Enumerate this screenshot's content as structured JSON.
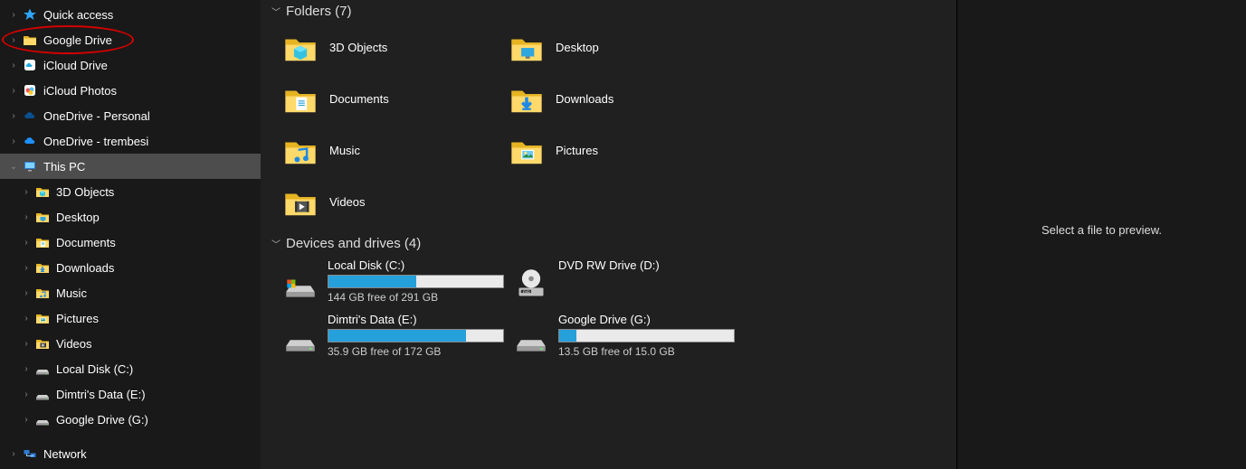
{
  "sidebar": {
    "items": [
      {
        "label": "Quick access",
        "icon": "star-icon",
        "expand": "right",
        "indent": 0
      },
      {
        "label": "Google Drive",
        "icon": "folder-icon",
        "expand": "right",
        "indent": 0,
        "circled": true
      },
      {
        "label": "iCloud Drive",
        "icon": "icloud-drive-icon",
        "expand": "right",
        "indent": 0
      },
      {
        "label": "iCloud Photos",
        "icon": "icloud-photos-icon",
        "expand": "right",
        "indent": 0
      },
      {
        "label": "OneDrive - Personal",
        "icon": "onedrive-icon",
        "expand": "right",
        "indent": 0
      },
      {
        "label": "OneDrive - trembesi",
        "icon": "onedrive-blue-icon",
        "expand": "right",
        "indent": 0
      },
      {
        "label": "This PC",
        "icon": "thispc-icon",
        "expand": "down",
        "indent": 0,
        "selected": true
      },
      {
        "label": "3D Objects",
        "icon": "3dobjects-icon",
        "expand": "right",
        "indent": 1
      },
      {
        "label": "Desktop",
        "icon": "desktop-icon",
        "expand": "right",
        "indent": 1
      },
      {
        "label": "Documents",
        "icon": "documents-icon",
        "expand": "right",
        "indent": 1
      },
      {
        "label": "Downloads",
        "icon": "downloads-icon",
        "expand": "right",
        "indent": 1
      },
      {
        "label": "Music",
        "icon": "music-icon",
        "expand": "right",
        "indent": 1
      },
      {
        "label": "Pictures",
        "icon": "pictures-icon",
        "expand": "right",
        "indent": 1
      },
      {
        "label": "Videos",
        "icon": "videos-icon",
        "expand": "right",
        "indent": 1
      },
      {
        "label": "Local Disk (C:)",
        "icon": "drive-icon",
        "expand": "right",
        "indent": 1
      },
      {
        "label": "Dimtri's Data (E:)",
        "icon": "drive-icon",
        "expand": "right",
        "indent": 1
      },
      {
        "label": "Google Drive (G:)",
        "icon": "drive-icon",
        "expand": "right",
        "indent": 1
      },
      {
        "label": "Network",
        "icon": "network-icon",
        "expand": "right",
        "indent": 0
      }
    ]
  },
  "main": {
    "folders_header": "Folders (7)",
    "folders": [
      {
        "label": "3D Objects",
        "icon": "3dobjects-big-icon"
      },
      {
        "label": "Desktop",
        "icon": "desktop-big-icon"
      },
      {
        "label": "Documents",
        "icon": "documents-big-icon"
      },
      {
        "label": "Downloads",
        "icon": "downloads-big-icon"
      },
      {
        "label": "Music",
        "icon": "music-big-icon"
      },
      {
        "label": "Pictures",
        "icon": "pictures-big-icon"
      },
      {
        "label": "Videos",
        "icon": "videos-big-icon"
      }
    ],
    "drives_header": "Devices and drives (4)",
    "drives": [
      {
        "label": "Local Disk (C:)",
        "icon": "cdrive-icon",
        "free": "144 GB free of 291 GB",
        "fill": 50,
        "bar": true
      },
      {
        "label": "DVD RW Drive (D:)",
        "icon": "dvd-icon",
        "free": "",
        "bar": false
      },
      {
        "label": "Dimtri's Data (E:)",
        "icon": "hdd-icon",
        "free": "35.9 GB free of 172 GB",
        "fill": 79,
        "bar": true
      },
      {
        "label": "Google Drive (G:)",
        "icon": "hdd-icon",
        "free": "13.5 GB free of 15.0 GB",
        "fill": 10,
        "bar": true
      }
    ]
  },
  "preview": {
    "text": "Select a file to preview."
  }
}
